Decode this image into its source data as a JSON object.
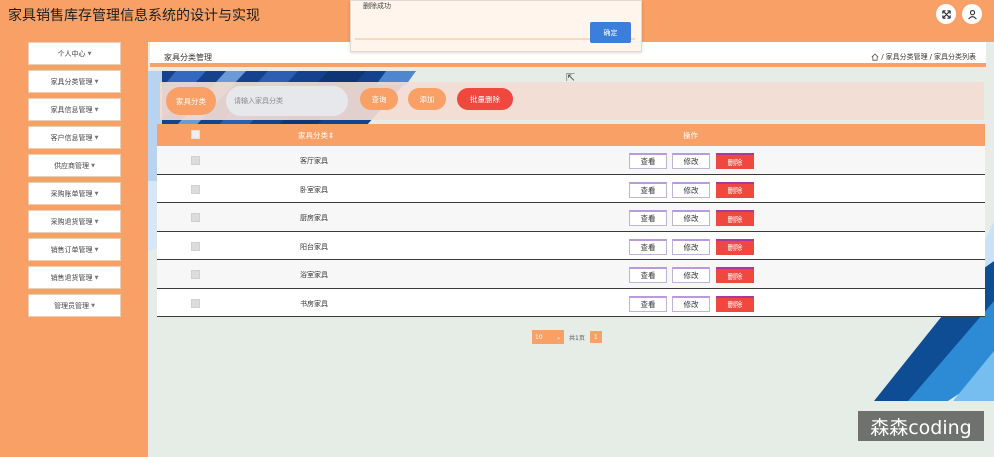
{
  "app": {
    "title": "家具销售库存管理信息系统的设计与实现",
    "icons": [
      "expand-icon",
      "user-icon"
    ]
  },
  "sidebar": {
    "items": [
      {
        "label": "个人中心"
      },
      {
        "label": "家具分类管理"
      },
      {
        "label": "家具信息管理"
      },
      {
        "label": "客户信息管理"
      },
      {
        "label": "供应商管理"
      },
      {
        "label": "采购账单管理"
      },
      {
        "label": "采购退货管理"
      },
      {
        "label": "销售订单管理"
      },
      {
        "label": "销售退货管理"
      },
      {
        "label": "管理员管理"
      }
    ]
  },
  "header": {
    "page_title": "家具分类管理",
    "breadcrumb": [
      "家具分类管理",
      "家具分类列表"
    ],
    "breadcrumb_sep": "/"
  },
  "search": {
    "label": "家具分类",
    "placeholder": "请输入家具分类",
    "query_button": "查询",
    "add_button": "添加",
    "batch_delete_button": "批量删除"
  },
  "table": {
    "columns": [
      "家具分类",
      "操作"
    ],
    "actions": {
      "view": "查看",
      "edit": "修改",
      "delete": "删除"
    },
    "rows": [
      "客厅家具",
      "卧室家具",
      "厨房家具",
      "阳台家具",
      "浴室家具",
      "书房家具"
    ]
  },
  "pagination": {
    "page_size": "10",
    "total_pages_label": "共1页",
    "current_page": "1"
  },
  "dialog": {
    "message": "删除成功",
    "ok_button": "确定"
  },
  "watermark": "森森coding",
  "colors": {
    "primary": "#f8a065",
    "danger": "#f0483e",
    "dialog_button": "#3c7edc",
    "content_bg": "#e6ede7"
  }
}
